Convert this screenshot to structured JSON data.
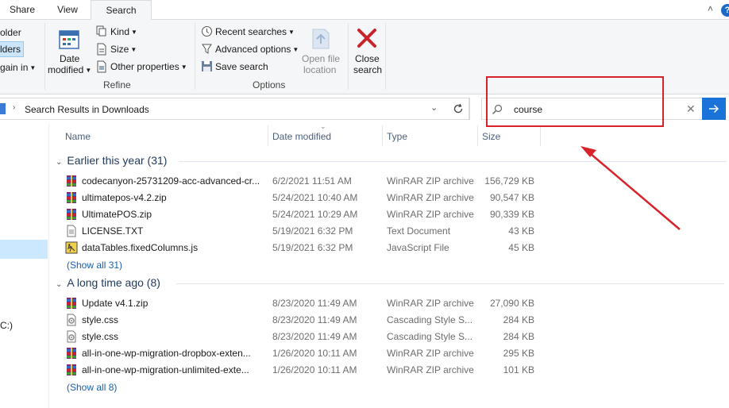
{
  "tabs": {
    "share": "Share",
    "view": "View",
    "search": "Search"
  },
  "help_glyph": "?",
  "ribbon": {
    "location": {
      "this_folder": "older",
      "subfolders": "lders",
      "search_again": "gain in"
    },
    "refine": {
      "date_modified_line1": "Date",
      "date_modified_line2": "modified",
      "kind": "Kind",
      "size": "Size",
      "other_properties": "Other properties",
      "group_label": "Refine"
    },
    "options": {
      "recent_searches": "Recent searches",
      "advanced_options": "Advanced options",
      "save_search": "Save search",
      "open_file_location_line1": "Open file",
      "open_file_location_line2": "location",
      "group_label": "Options"
    },
    "close_search_line1": "Close",
    "close_search_line2": "search"
  },
  "address": {
    "crumb": "Search Results in Downloads"
  },
  "search": {
    "query": "course"
  },
  "columns": {
    "name": "Name",
    "date_modified": "Date modified",
    "type": "Type",
    "size": "Size"
  },
  "left_pane": {
    "drive_fragment": "C:)"
  },
  "groups": [
    {
      "title": "Earlier this year (31)",
      "show_all": "(Show all 31)",
      "rows": [
        {
          "icon": "winrar-archive-icon",
          "name": "codecanyon-25731209-acc-advanced-cr...",
          "date": "6/2/2021 11:51 AM",
          "type": "WinRAR ZIP archive",
          "size": "156,729 KB"
        },
        {
          "icon": "winrar-archive-icon",
          "name": "ultimatepos-v4.2.zip",
          "date": "5/24/2021 10:40 AM",
          "type": "WinRAR ZIP archive",
          "size": "90,547 KB"
        },
        {
          "icon": "winrar-archive-icon",
          "name": "UltimatePOS.zip",
          "date": "5/24/2021 10:29 AM",
          "type": "WinRAR ZIP archive",
          "size": "90,339 KB"
        },
        {
          "icon": "text-document-icon",
          "name": "LICENSE.TXT",
          "date": "5/19/2021 6:32 PM",
          "type": "Text Document",
          "size": "43 KB"
        },
        {
          "icon": "javascript-file-icon",
          "name": "dataTables.fixedColumns.js",
          "date": "5/19/2021 6:32 PM",
          "type": "JavaScript File",
          "size": "45 KB"
        }
      ]
    },
    {
      "title": "A long time ago (8)",
      "show_all": "(Show all 8)",
      "rows": [
        {
          "icon": "winrar-archive-icon",
          "name": "Update v4.1.zip",
          "date": "8/23/2020 11:49 AM",
          "type": "WinRAR ZIP archive",
          "size": "27,090 KB"
        },
        {
          "icon": "css-file-icon",
          "name": "style.css",
          "date": "8/23/2020 11:49 AM",
          "type": "Cascading Style S...",
          "size": "284 KB"
        },
        {
          "icon": "css-file-icon",
          "name": "style.css",
          "date": "8/23/2020 11:49 AM",
          "type": "Cascading Style S...",
          "size": "284 KB"
        },
        {
          "icon": "winrar-archive-icon",
          "name": "all-in-one-wp-migration-dropbox-exten...",
          "date": "1/26/2020 10:11 AM",
          "type": "WinRAR ZIP archive",
          "size": "295 KB"
        },
        {
          "icon": "winrar-archive-icon",
          "name": "all-in-one-wp-migration-unlimited-exte...",
          "date": "1/26/2020 10:11 AM",
          "type": "WinRAR ZIP archive",
          "size": "101 KB"
        }
      ]
    }
  ],
  "colors": {
    "accent": "#1a73d8",
    "annotation": "#d9232a",
    "group_header": "#1e395b"
  }
}
